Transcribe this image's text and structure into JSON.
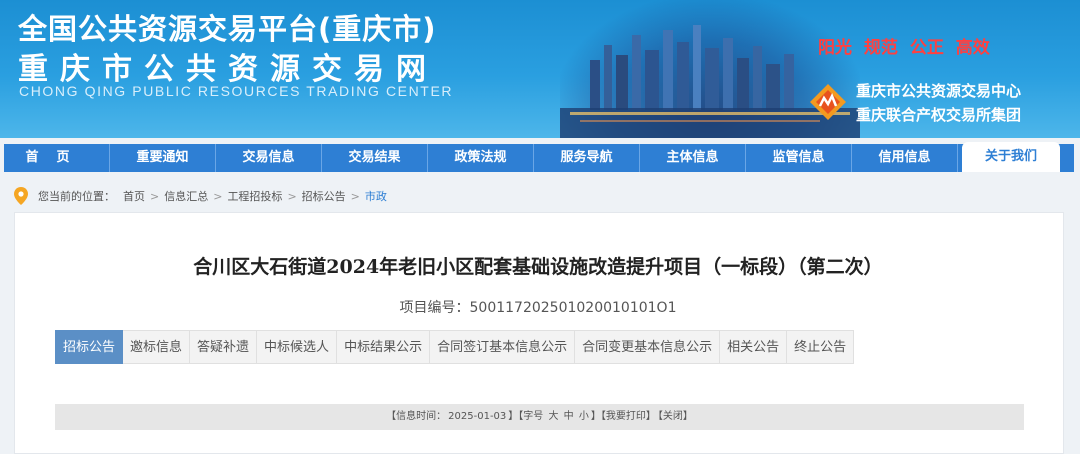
{
  "header": {
    "title_cn": "全国公共资源交易平台(重庆市)",
    "site_name": "重庆市公共资源交易网",
    "title_en": "CHONG QING PUBLIC RESOURCES TRADING CENTER",
    "slogan": "阳光  规范  公正  高效",
    "org_line1": "重庆市公共资源交易中心",
    "org_line2": "重庆联合产权交易所集团",
    "colors": {
      "banner": "#2a9fe0",
      "slogan": "#ff4040"
    }
  },
  "nav": {
    "items": [
      "首页",
      "重要通知",
      "交易信息",
      "交易结果",
      "政策法规",
      "服务导航",
      "主体信息",
      "监管信息",
      "信用信息",
      "关于我们"
    ],
    "active_index": 9,
    "color": "#2e7fd4"
  },
  "breadcrumb": {
    "prefix": "您当前的位置：",
    "items": [
      "首页",
      "信息汇总",
      "工程招投标",
      "招标公告",
      "市政"
    ],
    "separator": ">"
  },
  "article": {
    "title": "合川区大石街道2024年老旧小区配套基础设施改造提升项目（一标段）（第二次）",
    "project_no_label": "项目编号：",
    "project_no": "500117202501020010101O1",
    "tabs": [
      "招标公告",
      "邀标信息",
      "答疑补遗",
      "中标候选人",
      "中标结果公示",
      "合同签订基本信息公示",
      "合同变更基本信息公示",
      "相关公告",
      "终止公告"
    ],
    "active_tab": 0,
    "info_bar": {
      "time_label": "【信息时间：",
      "time_value": "2025-01-03",
      "font_label": "】【字号",
      "font_large": "大",
      "font_medium": "中",
      "font_small": "小",
      "print": "】【我要打印】",
      "close": "【关闭】"
    }
  }
}
